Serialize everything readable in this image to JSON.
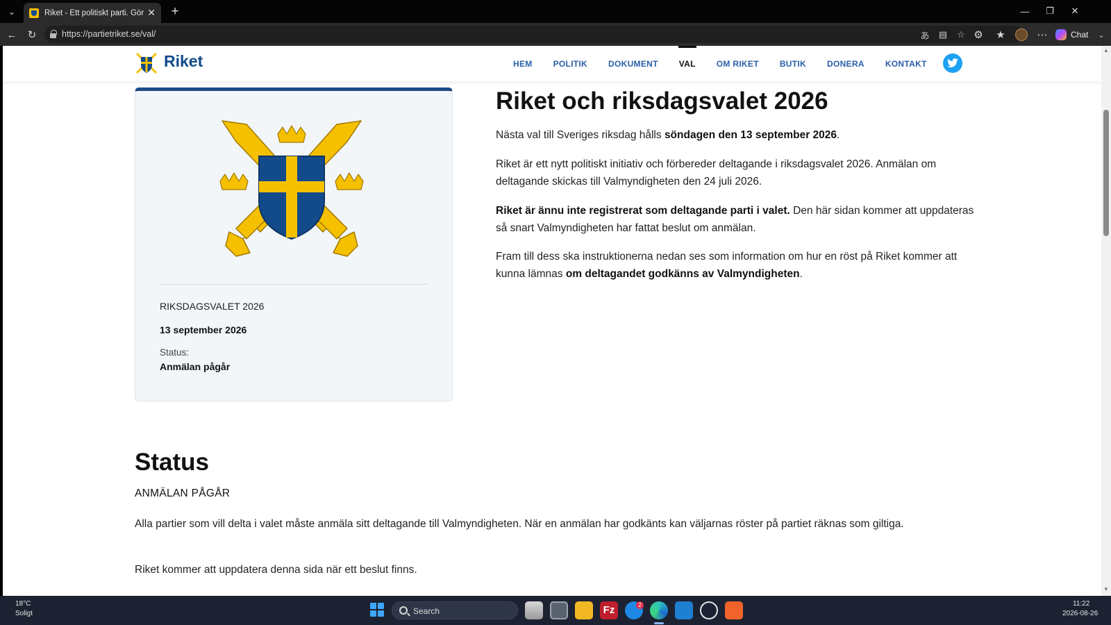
{
  "browser": {
    "tab_title": "Riket - Ett politiskt parti. Gör Sverige",
    "url": "https://partietriket.se/val/",
    "chat_label": "Chat"
  },
  "site": {
    "logo_text": "Riket",
    "nav": [
      {
        "label": "HEM"
      },
      {
        "label": "POLITIK"
      },
      {
        "label": "DOKUMENT"
      },
      {
        "label": "VAL",
        "active": true
      },
      {
        "label": "OM RIKET"
      },
      {
        "label": "BUTIK"
      },
      {
        "label": "DONERA"
      },
      {
        "label": "KONTAKT"
      }
    ]
  },
  "card": {
    "election": "RIKSDAGSVALET 2026",
    "date": "13 september 2026",
    "status_label": "Status:",
    "status_value": "Anmälan pågår"
  },
  "main": {
    "title": "Riket och riksdagsvalet 2026",
    "p1_pre": "Nästa val till Sveriges riksdag hålls ",
    "p1_bold": "söndagen den 13 september 2026",
    "p1_post": ".",
    "p2": "Riket är ett nytt politiskt initiativ och förbereder deltagande i riksdagsvalet 2026. Anmälan om deltagande skickas till Valmyndigheten den 24 juli 2026.",
    "p3_bold": "Riket är ännu inte registrerat som deltagande parti i valet.",
    "p3_post": " Den här sidan kommer att uppdateras så snart Valmyndigheten har fattat beslut om anmälan.",
    "p4_pre": "Fram till dess ska instruktionerna nedan ses som information om hur en röst på Riket kommer att kunna lämnas ",
    "p4_bold": "om deltagandet godkänns av Valmyndigheten",
    "p4_post": "."
  },
  "status": {
    "title": "Status",
    "subtitle": "ANMÄLAN PÅGÅR",
    "p1": "Alla partier som vill delta i valet måste anmäla sitt deltagande till Valmyndigheten. När en anmälan har godkänts kan väljarnas röster på partiet räknas som giltiga.",
    "p2": "Riket kommer att uppdatera denna sida när ett beslut finns."
  },
  "colors": {
    "brand_blue": "#134a8a",
    "brand_yellow": "#f5c000",
    "nav_link": "#2a5fa8",
    "twitter": "#1da1f2"
  },
  "taskbar": {
    "weather_temp": "18°C",
    "weather_cond": "Soligt",
    "search_label": "Search",
    "notification_count": "2",
    "time": "11:22",
    "date": "2026-08-26"
  }
}
